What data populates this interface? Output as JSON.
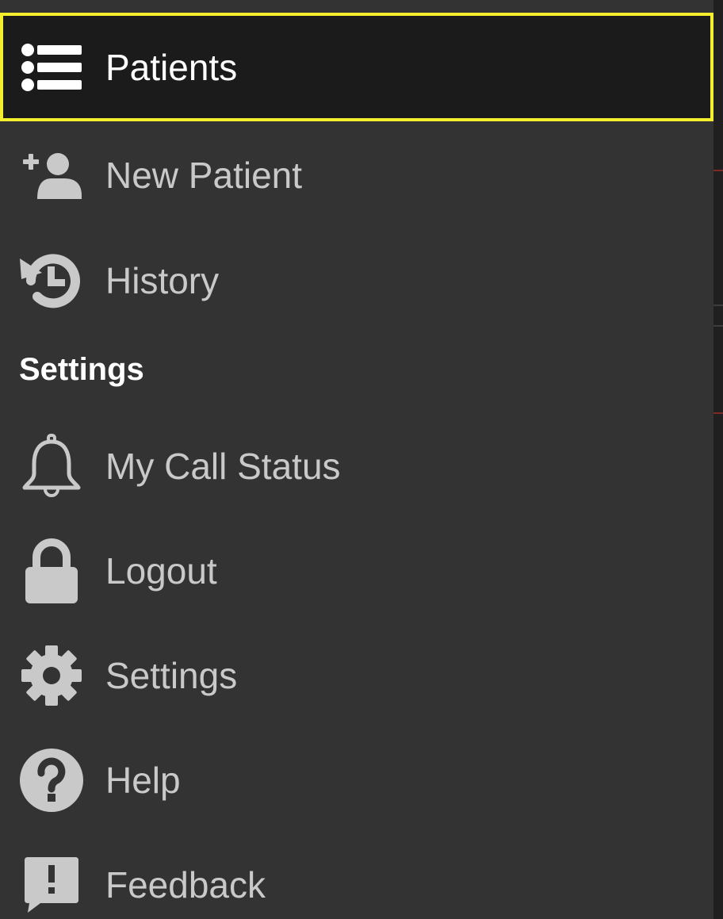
{
  "drawer": {
    "primary_items": [
      {
        "label": "Patients",
        "icon": "list-icon",
        "active": true
      },
      {
        "label": "New Patient",
        "icon": "add-user-icon",
        "active": false
      },
      {
        "label": "History",
        "icon": "history-icon",
        "active": false
      }
    ],
    "settings_header": "Settings",
    "settings_items": [
      {
        "label": "My Call Status",
        "icon": "bell-icon"
      },
      {
        "label": "Logout",
        "icon": "lock-icon"
      },
      {
        "label": "Settings",
        "icon": "gear-icon"
      },
      {
        "label": "Help",
        "icon": "help-icon"
      },
      {
        "label": "Feedback",
        "icon": "feedback-icon"
      }
    ]
  },
  "colors": {
    "drawer_background": "#333333",
    "active_background": "#1b1b1b",
    "active_border": "#f5ee2e",
    "label_text": "#c9c9c9",
    "active_label_text": "#ffffff"
  }
}
